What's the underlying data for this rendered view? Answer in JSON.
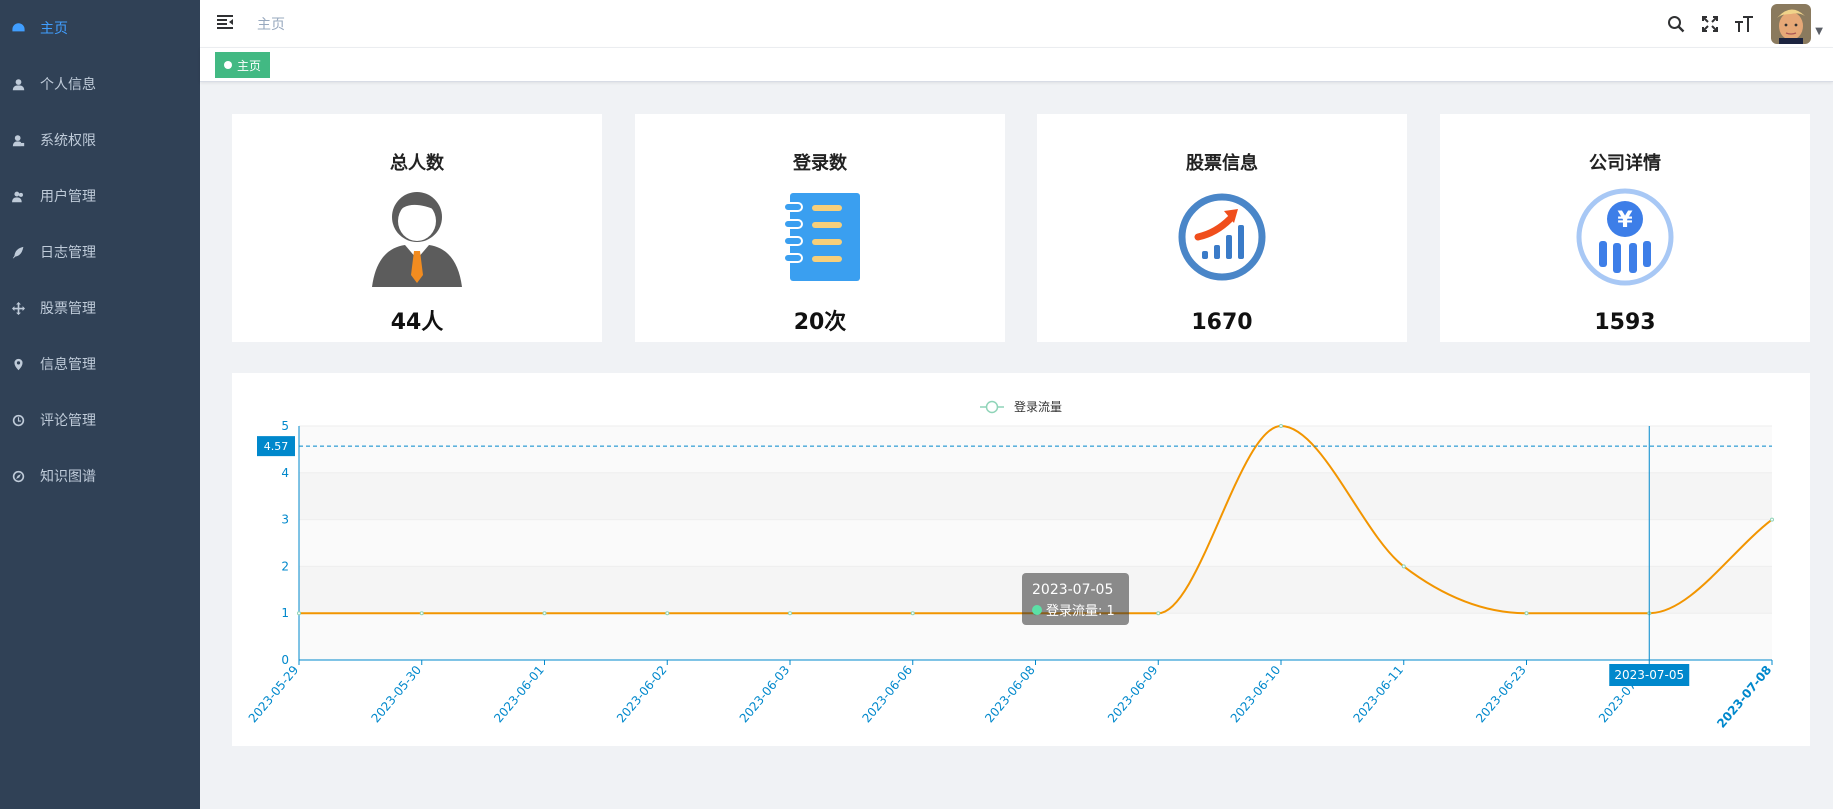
{
  "sidebar": {
    "items": [
      {
        "label": "主页",
        "icon": "dashboard-icon",
        "active": true
      },
      {
        "label": "个人信息",
        "icon": "user-icon"
      },
      {
        "label": "系统权限",
        "icon": "user-lock-icon"
      },
      {
        "label": "用户管理",
        "icon": "users-icon"
      },
      {
        "label": "日志管理",
        "icon": "feather-icon"
      },
      {
        "label": "股票管理",
        "icon": "move-icon"
      },
      {
        "label": "信息管理",
        "icon": "location-icon"
      },
      {
        "label": "评论管理",
        "icon": "clock-icon"
      },
      {
        "label": "知识图谱",
        "icon": "compass-icon"
      }
    ]
  },
  "header": {
    "breadcrumb": "主页",
    "icons": [
      "search-icon",
      "fullscreen-icon",
      "font-size-icon"
    ]
  },
  "tags": {
    "active": "主页"
  },
  "cards": [
    {
      "title": "总人数",
      "value": "44人",
      "icon": "person-icon"
    },
    {
      "title": "登录数",
      "value": "20次",
      "icon": "notebook-icon"
    },
    {
      "title": "股票信息",
      "value": "1670",
      "icon": "stock-chart-icon"
    },
    {
      "title": "公司详情",
      "value": "1593",
      "icon": "yuan-chart-icon"
    }
  ],
  "chart_data": {
    "type": "line",
    "legend": [
      "登录流量"
    ],
    "categories": [
      "2023-05-29",
      "2023-05-30",
      "2023-06-01",
      "2023-06-02",
      "2023-06-03",
      "2023-06-06",
      "2023-06-08",
      "2023-06-09",
      "2023-06-10",
      "2023-06-11",
      "2023-06-23",
      "2023-07-05",
      "2023-07-08"
    ],
    "series": [
      {
        "name": "登录流量",
        "values": [
          1,
          1,
          1,
          1,
          1,
          1,
          1,
          1,
          5,
          2,
          1,
          1,
          3
        ]
      }
    ],
    "ylim": [
      0,
      5
    ],
    "yticks": [
      0,
      1,
      2,
      3,
      4,
      5
    ],
    "crosshair": {
      "y_label": "4.57",
      "y_value": 4.57,
      "x_label": "2023-07-05",
      "x_index": 11
    },
    "tooltip": {
      "title": "2023-07-05",
      "series": "登录流量",
      "value": "1"
    },
    "line_color": "#f29500",
    "axis_color": "#0088cc"
  }
}
